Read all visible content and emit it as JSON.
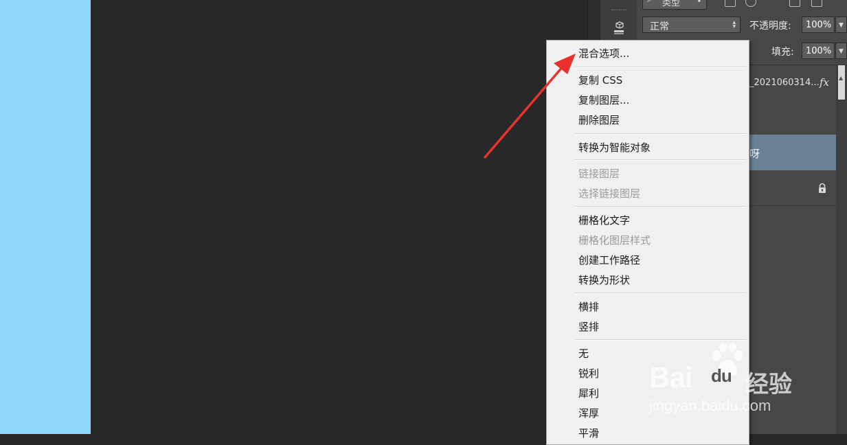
{
  "canvas": {
    "left_color": "#8fd8f7",
    "bg_color": "#282828"
  },
  "layers_panel": {
    "filter_label": "类型",
    "blend_mode": "正常",
    "opacity_label": "不透明度:",
    "opacity_value": "100%",
    "fill_label": "填充:",
    "fill_value": "100%",
    "layers": [
      {
        "name": "_2021060314...",
        "fx": "fx"
      },
      {
        "name": "呀",
        "selected": true
      },
      {
        "name": "",
        "locked": true
      }
    ],
    "selected_color": "#6b7f97"
  },
  "context_menu": {
    "groups": [
      [
        {
          "label": "混合选项...",
          "enabled": true
        }
      ],
      [
        {
          "label": "复制 CSS",
          "enabled": true
        },
        {
          "label": "复制图层...",
          "enabled": true
        },
        {
          "label": "删除图层",
          "enabled": true
        }
      ],
      [
        {
          "label": "转换为智能对象",
          "enabled": true
        }
      ],
      [
        {
          "label": "链接图层",
          "enabled": false
        },
        {
          "label": "选择链接图层",
          "enabled": false
        }
      ],
      [
        {
          "label": "栅格化文字",
          "enabled": true
        },
        {
          "label": "栅格化图层样式",
          "enabled": false
        },
        {
          "label": "创建工作路径",
          "enabled": true
        },
        {
          "label": "转换为形状",
          "enabled": true
        }
      ],
      [
        {
          "label": "横排",
          "enabled": true
        },
        {
          "label": "竖排",
          "enabled": true
        }
      ],
      [
        {
          "label": "无",
          "enabled": true
        },
        {
          "label": "锐利",
          "enabled": true
        },
        {
          "label": "犀利",
          "enabled": true
        },
        {
          "label": "浑厚",
          "enabled": true
        },
        {
          "label": "平滑",
          "enabled": true
        }
      ]
    ]
  },
  "annotation": {
    "color": "#e8322b",
    "icon": "red-arrow-icon"
  },
  "watermark": {
    "brand": "Bai",
    "brand_du": "du",
    "brand_cn": "经验",
    "url": "jingyan.baidu.com"
  }
}
